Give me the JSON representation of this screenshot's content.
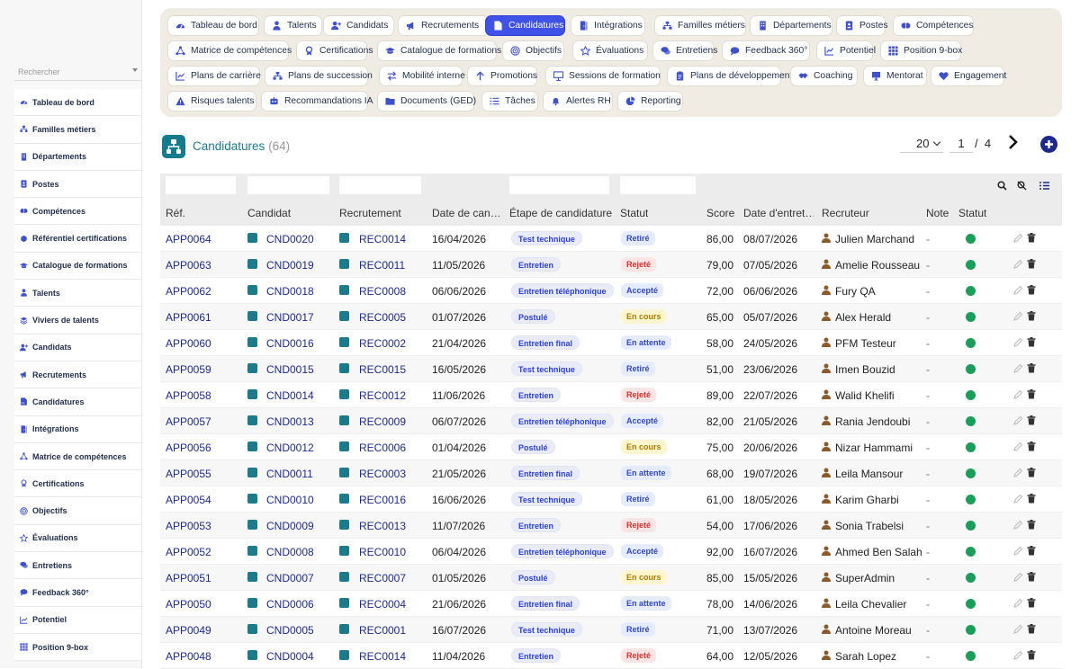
{
  "sidebar": {
    "search_placeholder": "Rechercher",
    "items": [
      {
        "label": "Tableau de bord",
        "icon": "dashboard-icon"
      },
      {
        "label": "Familles métiers",
        "icon": "sitemap-icon"
      },
      {
        "label": "Départements",
        "icon": "building-icon"
      },
      {
        "label": "Postes",
        "icon": "id-badge-icon"
      },
      {
        "label": "Compétences",
        "icon": "brain-icon"
      },
      {
        "label": "Référentiel certifications",
        "icon": "certificate-icon"
      },
      {
        "label": "Catalogue de formations",
        "icon": "graduation-cap-icon"
      },
      {
        "label": "Talents",
        "icon": "user-tie-icon"
      },
      {
        "label": "Viviers de talents",
        "icon": "layers-icon"
      },
      {
        "label": "Candidats",
        "icon": "user-plus-icon"
      },
      {
        "label": "Recrutements",
        "icon": "megaphone-icon"
      },
      {
        "label": "Candidatures",
        "icon": "file-signature-icon"
      },
      {
        "label": "Intégrations",
        "icon": "door-icon"
      },
      {
        "label": "Matrice de compétences",
        "icon": "network-icon"
      },
      {
        "label": "Certifications",
        "icon": "award-icon"
      },
      {
        "label": "Objectifs",
        "icon": "target-icon"
      },
      {
        "label": "Évaluations",
        "icon": "star-icon"
      },
      {
        "label": "Entretiens",
        "icon": "comments-icon"
      },
      {
        "label": "Feedback 360°",
        "icon": "comment-icon"
      },
      {
        "label": "Potentiel",
        "icon": "chart-line-icon"
      },
      {
        "label": "Position 9-box",
        "icon": "grid-icon"
      }
    ]
  },
  "topmenu": [
    {
      "label": "Tableau de bord",
      "icon": "dashboard-icon",
      "active": false
    },
    {
      "label": "Talents",
      "icon": "user-tie-icon",
      "active": false
    },
    {
      "label": "Candidats",
      "icon": "user-plus-icon",
      "active": false
    },
    {
      "label": "Recrutements",
      "icon": "megaphone-icon",
      "active": false
    },
    {
      "label": "Candidatures",
      "icon": "file-signature-icon",
      "active": true
    },
    {
      "label": "Intégrations",
      "icon": "door-icon",
      "active": false
    },
    {
      "label": "Familles métiers",
      "icon": "sitemap-icon",
      "active": false
    },
    {
      "label": "Départements",
      "icon": "building-icon",
      "active": false
    },
    {
      "label": "Postes",
      "icon": "id-badge-icon",
      "active": false
    },
    {
      "label": "Compétences",
      "icon": "brain-icon",
      "active": false
    },
    {
      "label": "Matrice de compétences",
      "icon": "network-icon",
      "active": false
    },
    {
      "label": "Certifications",
      "icon": "award-icon",
      "active": false
    },
    {
      "label": "Catalogue de formations",
      "icon": "graduation-cap-icon",
      "active": false
    },
    {
      "label": "Objectifs",
      "icon": "target-icon",
      "active": false
    },
    {
      "label": "Évaluations",
      "icon": "star-icon",
      "active": false
    },
    {
      "label": "Entretiens",
      "icon": "comments-icon",
      "active": false
    },
    {
      "label": "Feedback 360°",
      "icon": "comment-icon",
      "active": false
    },
    {
      "label": "Potentiel",
      "icon": "chart-line-icon",
      "active": false
    },
    {
      "label": "Position 9-box",
      "icon": "grid-icon",
      "active": false
    },
    {
      "label": "Plans de carrière",
      "icon": "chart-line-icon",
      "active": false
    },
    {
      "label": "Plans de succession",
      "icon": "sitemap-icon",
      "active": false
    },
    {
      "label": "Mobilité interne",
      "icon": "exchange-icon",
      "active": false
    },
    {
      "label": "Promotions",
      "icon": "arrow-up-icon",
      "active": false
    },
    {
      "label": "Sessions de formation",
      "icon": "presentation-icon",
      "active": false
    },
    {
      "label": "Plans de développement",
      "icon": "clipboard-icon",
      "active": false
    },
    {
      "label": "Coaching",
      "icon": "handshake-icon",
      "active": false
    },
    {
      "label": "Mentorat",
      "icon": "chalkboard-icon",
      "active": false
    },
    {
      "label": "Engagement",
      "icon": "heart-icon",
      "active": false
    },
    {
      "label": "Risques talents",
      "icon": "warning-icon",
      "active": false
    },
    {
      "label": "Recommandations IA",
      "icon": "robot-icon",
      "active": false
    },
    {
      "label": "Documents (GED)",
      "icon": "folder-icon",
      "active": false
    },
    {
      "label": "Tâches",
      "icon": "tasks-icon",
      "active": false
    },
    {
      "label": "Alertes RH",
      "icon": "bell-icon",
      "active": false
    },
    {
      "label": "Reporting",
      "icon": "pie-chart-icon",
      "active": false
    }
  ],
  "page": {
    "title": "Candidatures",
    "count": "(64)",
    "per_page": "20",
    "current_page": "1",
    "page_separator": "/",
    "total_pages": "4"
  },
  "table": {
    "columns": [
      "Réf.",
      "Candidat",
      "Recrutement",
      "Date de can…",
      "Étape de candidature",
      "Statut",
      "Score",
      "Date d'entret…",
      "Recruteur",
      "Note",
      "Statut"
    ],
    "rows": [
      {
        "ref": "APP0064",
        "cand": "CND0020",
        "rec": "REC0014",
        "date": "16/04/2026",
        "stage": "Test technique",
        "status": "Retiré",
        "status_color": "blue",
        "score": "86,00",
        "interview": "08/07/2026",
        "recruiter": "Julien Marchand",
        "note": "-"
      },
      {
        "ref": "APP0063",
        "cand": "CND0019",
        "rec": "REC0011",
        "date": "11/05/2026",
        "stage": "Entretien",
        "status": "Rejeté",
        "status_color": "red",
        "score": "79,00",
        "interview": "07/05/2026",
        "recruiter": "Amelie Rousseau",
        "note": "-"
      },
      {
        "ref": "APP0062",
        "cand": "CND0018",
        "rec": "REC0008",
        "date": "06/06/2026",
        "stage": "Entretien téléphonique",
        "status": "Accepté",
        "status_color": "blue",
        "score": "72,00",
        "interview": "06/06/2026",
        "recruiter": "Fury QA",
        "note": "-"
      },
      {
        "ref": "APP0061",
        "cand": "CND0017",
        "rec": "REC0005",
        "date": "01/07/2026",
        "stage": "Postulé",
        "status": "En cours",
        "status_color": "yellow",
        "score": "65,00",
        "interview": "05/07/2026",
        "recruiter": "Alex Herald",
        "note": "-"
      },
      {
        "ref": "APP0060",
        "cand": "CND0016",
        "rec": "REC0002",
        "date": "21/04/2026",
        "stage": "Entretien final",
        "status": "En attente",
        "status_color": "blue",
        "score": "58,00",
        "interview": "24/05/2026",
        "recruiter": "PFM Testeur",
        "note": "-"
      },
      {
        "ref": "APP0059",
        "cand": "CND0015",
        "rec": "REC0015",
        "date": "16/05/2026",
        "stage": "Test technique",
        "status": "Retiré",
        "status_color": "blue",
        "score": "51,00",
        "interview": "23/06/2026",
        "recruiter": "Imen Bouzid",
        "note": "-"
      },
      {
        "ref": "APP0058",
        "cand": "CND0014",
        "rec": "REC0012",
        "date": "11/06/2026",
        "stage": "Entretien",
        "status": "Rejeté",
        "status_color": "red",
        "score": "89,00",
        "interview": "22/07/2026",
        "recruiter": "Walid Khelifi",
        "note": "-"
      },
      {
        "ref": "APP0057",
        "cand": "CND0013",
        "rec": "REC0009",
        "date": "06/07/2026",
        "stage": "Entretien téléphonique",
        "status": "Accepté",
        "status_color": "blue",
        "score": "82,00",
        "interview": "21/05/2026",
        "recruiter": "Rania Jendoubi",
        "note": "-"
      },
      {
        "ref": "APP0056",
        "cand": "CND0012",
        "rec": "REC0006",
        "date": "01/04/2026",
        "stage": "Postulé",
        "status": "En cours",
        "status_color": "yellow",
        "score": "75,00",
        "interview": "20/06/2026",
        "recruiter": "Nizar Hammami",
        "note": "-"
      },
      {
        "ref": "APP0055",
        "cand": "CND0011",
        "rec": "REC0003",
        "date": "21/05/2026",
        "stage": "Entretien final",
        "status": "En attente",
        "status_color": "blue",
        "score": "68,00",
        "interview": "19/07/2026",
        "recruiter": "Leila Mansour",
        "note": "-"
      },
      {
        "ref": "APP0054",
        "cand": "CND0010",
        "rec": "REC0016",
        "date": "16/06/2026",
        "stage": "Test technique",
        "status": "Retiré",
        "status_color": "blue",
        "score": "61,00",
        "interview": "18/05/2026",
        "recruiter": "Karim Gharbi",
        "note": "-"
      },
      {
        "ref": "APP0053",
        "cand": "CND0009",
        "rec": "REC0013",
        "date": "11/07/2026",
        "stage": "Entretien",
        "status": "Rejeté",
        "status_color": "red",
        "score": "54,00",
        "interview": "17/06/2026",
        "recruiter": "Sonia Trabelsi",
        "note": "-"
      },
      {
        "ref": "APP0052",
        "cand": "CND0008",
        "rec": "REC0010",
        "date": "06/04/2026",
        "stage": "Entretien téléphonique",
        "status": "Accepté",
        "status_color": "blue",
        "score": "92,00",
        "interview": "16/07/2026",
        "recruiter": "Ahmed Ben Salah",
        "note": "-"
      },
      {
        "ref": "APP0051",
        "cand": "CND0007",
        "rec": "REC0007",
        "date": "01/05/2026",
        "stage": "Postulé",
        "status": "En cours",
        "status_color": "yellow",
        "score": "85,00",
        "interview": "15/05/2026",
        "recruiter": "SuperAdmin",
        "note": "-"
      },
      {
        "ref": "APP0050",
        "cand": "CND0006",
        "rec": "REC0004",
        "date": "21/06/2026",
        "stage": "Entretien final",
        "status": "En attente",
        "status_color": "blue",
        "score": "78,00",
        "interview": "14/06/2026",
        "recruiter": "Leila Chevalier",
        "note": "-"
      },
      {
        "ref": "APP0049",
        "cand": "CND0005",
        "rec": "REC0001",
        "date": "16/07/2026",
        "stage": "Test technique",
        "status": "Retiré",
        "status_color": "blue",
        "score": "71,00",
        "interview": "13/07/2026",
        "recruiter": "Antoine Moreau",
        "note": "-"
      },
      {
        "ref": "APP0048",
        "cand": "CND0004",
        "rec": "REC0014",
        "date": "11/04/2026",
        "stage": "Entretien",
        "status": "Rejeté",
        "status_color": "red",
        "score": "64,00",
        "interview": "12/05/2026",
        "recruiter": "Sarah Lopez",
        "note": "-"
      }
    ]
  },
  "colors": {
    "accent": "#3f51e6",
    "teal": "#1d7a8a",
    "navy": "#1d2a8c",
    "active_dot": "#1c9e5b"
  }
}
